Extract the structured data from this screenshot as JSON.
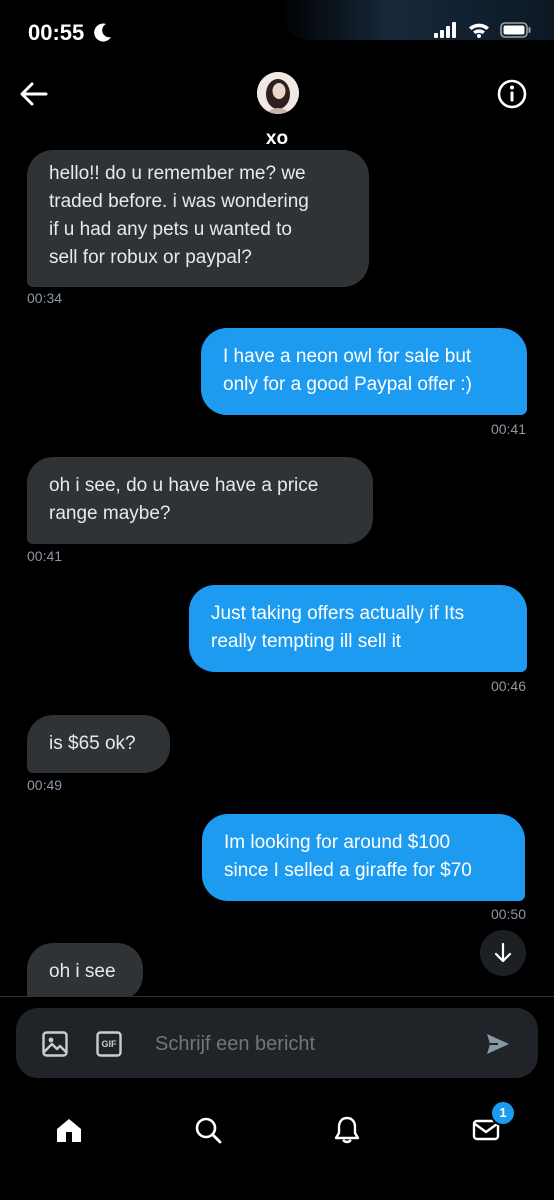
{
  "status_bar": {
    "time": "00:55"
  },
  "header": {
    "contact_name": "xo"
  },
  "messages": [
    {
      "direction": "in",
      "lines": [
        "hello!! do u remember me? we",
        "traded before. i was wondering",
        "if u had any pets u wanted to",
        "sell for robux or paypal?"
      ],
      "time": "00:34"
    },
    {
      "direction": "out",
      "lines": [
        "I have a neon owl for sale but",
        "only for a good Paypal offer :)"
      ],
      "time": "00:41"
    },
    {
      "direction": "in",
      "lines": [
        "oh i see, do u have have a price",
        "range maybe?"
      ],
      "time": "00:41"
    },
    {
      "direction": "out",
      "lines": [
        "Just taking offers actually if Its",
        "really tempting ill sell it"
      ],
      "time": "00:46"
    },
    {
      "direction": "in",
      "lines": [
        "is $65 ok?"
      ],
      "time": "00:49"
    },
    {
      "direction": "out",
      "lines": [
        "Im looking for around $100",
        "since I selled a giraffe for $70"
      ],
      "time": "00:50"
    },
    {
      "direction": "in",
      "lines": [
        "oh i see"
      ],
      "time": ""
    }
  ],
  "composer": {
    "placeholder": "Schrijf een bericht",
    "gif_label": "GIF"
  },
  "bottom_nav": {
    "messages_badge": "1"
  },
  "colors": {
    "accent": "#1d9bf0",
    "incoming_bubble": "#2f3336",
    "background": "#000000"
  }
}
